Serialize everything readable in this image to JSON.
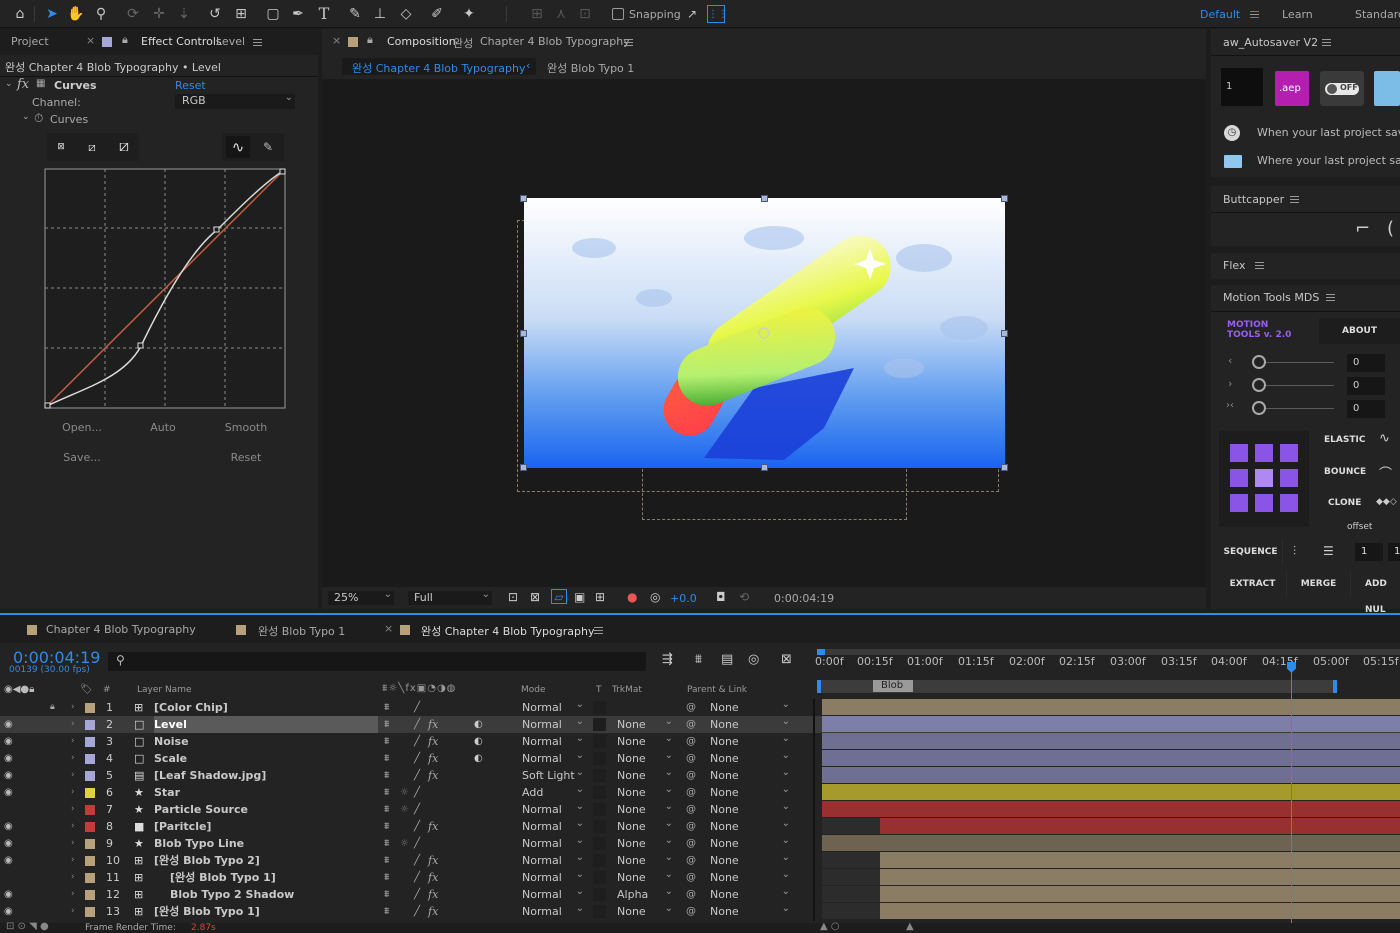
{
  "toolbar": {
    "snapping_label": "Snapping",
    "workspaces": [
      "Default",
      "Learn",
      "Standard"
    ],
    "active_workspace": "Default"
  },
  "project_panel": {
    "tab_project": "Project",
    "tab_effect_controls": "Effect Controls",
    "effect_target": "Level",
    "breadcrumb": "완성 Chapter 4 Blob Typography • Level",
    "effect_name": "Curves",
    "reset_label": "Reset",
    "channel_label": "Channel:",
    "channel_value": "RGB",
    "curves_label": "Curves",
    "buttons": {
      "open": "Open...",
      "auto": "Auto",
      "smooth": "Smooth",
      "save": "Save...",
      "reset": "Reset"
    }
  },
  "comp_panel": {
    "tab_prefix": "Composition",
    "tab_name_kr": "완성",
    "tab_name": "Chapter 4 Blob Typography",
    "flow_active": "완성 Chapter 4 Blob Typography",
    "flow_next": "완성 Blob Typo 1",
    "zoom": "25%",
    "resolution": "Full",
    "exposure": "+0.0",
    "timecode": "0:00:04:19"
  },
  "right_panel": {
    "autosaver_title": "aw_Autosaver V2",
    "autosaver_count": "1",
    "aep_label": ".aep",
    "toggle_label": "OFF",
    "autosaver_when": "When your last project saved",
    "autosaver_where": "Where your last project saved",
    "buttcapper_title": "Buttcapper",
    "flex_title": "Flex",
    "motion_tools_title": "Motion Tools MDS",
    "mt_logo_line1": "MOTION",
    "mt_logo_line2": "TOOLS v. 2.0",
    "mt_about": "ABOUT",
    "mt_values": [
      "0",
      "0",
      "0"
    ],
    "mt_elastic": "ELASTIC",
    "mt_bounce": "BOUNCE",
    "mt_clone": "CLONE",
    "mt_offset": "offset",
    "mt_sequence": "SEQUENCE",
    "mt_seq_value": "1",
    "mt_seq_value2": "1",
    "mt_extract": "EXTRACT",
    "mt_merge": "MERGE",
    "mt_add_null": "ADD NUL"
  },
  "timeline": {
    "tabs": [
      "Chapter 4 Blob Typography",
      "완성 Blob Typo 1",
      "완성 Chapter 4 Blob Typography"
    ],
    "timecode": "0:00:04:19",
    "frames": "00139 (30.00 fps)",
    "headers": {
      "layer_name": "Layer Name",
      "mode": "Mode",
      "t": "T",
      "trkmat": "TrkMat",
      "parent": "Parent & Link",
      "hash": "#"
    },
    "ruler": [
      "0:00f",
      "00:15f",
      "01:00f",
      "01:15f",
      "02:00f",
      "02:15f",
      "03:00f",
      "03:15f",
      "04:00f",
      "04:15f",
      "05:00f",
      "05:15f"
    ],
    "marker_label": "Blob",
    "footer_label": "Frame Render Time:",
    "footer_value": "2.87s",
    "layers": [
      {
        "num": "1",
        "name": "[Color Chip]",
        "mode": "Normal",
        "trkmat": "",
        "parent": "None",
        "label_color": "#b8a07a",
        "visible": false,
        "type": "comp",
        "bar_color": "#8a7d64",
        "bar_start": 0,
        "locked": true
      },
      {
        "num": "2",
        "name": "Level",
        "mode": "Normal",
        "trkmat": "None",
        "parent": "None",
        "label_color": "#a6a7d6",
        "visible": true,
        "type": "solid",
        "bar_color": "#7e7fa8",
        "bar_start": 0,
        "selected": true
      },
      {
        "num": "3",
        "name": "Noise",
        "mode": "Normal",
        "trkmat": "None",
        "parent": "None",
        "label_color": "#a6a7d6",
        "visible": true,
        "type": "solid",
        "bar_color": "#6e6f92",
        "bar_start": 0
      },
      {
        "num": "4",
        "name": "Scale",
        "mode": "Normal",
        "trkmat": "None",
        "parent": "None",
        "label_color": "#a6a7d6",
        "visible": true,
        "type": "solid",
        "bar_color": "#6e6f92",
        "bar_start": 0
      },
      {
        "num": "5",
        "name": "[Leaf Shadow.jpg]",
        "mode": "Soft Light",
        "trkmat": "None",
        "parent": "None",
        "label_color": "#a6a7d6",
        "visible": true,
        "type": "footage",
        "bar_color": "#6e6f92",
        "bar_start": 0
      },
      {
        "num": "6",
        "name": "Star",
        "mode": "Add",
        "trkmat": "None",
        "parent": "None",
        "label_color": "#e0d33a",
        "visible": true,
        "type": "shape",
        "bar_color": "#a79a2c",
        "bar_start": 0
      },
      {
        "num": "7",
        "name": "Particle Source",
        "mode": "Normal",
        "trkmat": "None",
        "parent": "None",
        "label_color": "#c83a3a",
        "visible": false,
        "type": "shape",
        "bar_color": "#983030",
        "bar_start": 0
      },
      {
        "num": "8",
        "name": "[Paritcle]",
        "mode": "Normal",
        "trkmat": "None",
        "parent": "None",
        "label_color": "#c83a3a",
        "visible": true,
        "type": "solid-dark",
        "bar_color": "#983030",
        "bar_start": 0.1
      },
      {
        "num": "9",
        "name": "Blob Typo Line",
        "mode": "Normal",
        "trkmat": "None",
        "parent": "None",
        "label_color": "#b8a07a",
        "visible": true,
        "type": "shape",
        "bar_color": "#6e6350",
        "bar_start": 0
      },
      {
        "num": "10",
        "name": "[완성 Blob Typo 2]",
        "mode": "Normal",
        "trkmat": "None",
        "parent": "None",
        "label_color": "#b8a07a",
        "visible": true,
        "type": "comp",
        "bar_color": "#8a7d64",
        "bar_start": 0.1
      },
      {
        "num": "11",
        "name": "[완성 Blob Typo 1]",
        "mode": "Normal",
        "trkmat": "None",
        "parent": "None",
        "label_color": "#b8a07a",
        "visible": false,
        "type": "comp-track",
        "bar_color": "#8a7d64",
        "bar_start": 0.1
      },
      {
        "num": "12",
        "name": "Blob Typo 2 Shadow",
        "mode": "Normal",
        "trkmat": "Alpha",
        "parent": "None",
        "label_color": "#b8a07a",
        "visible": true,
        "type": "comp-track",
        "bar_color": "#8a7d64",
        "bar_start": 0.1
      },
      {
        "num": "13",
        "name": "[완성 Blob Typo 1]",
        "mode": "Normal",
        "trkmat": "None",
        "parent": "None",
        "label_color": "#b8a07a",
        "visible": true,
        "type": "comp",
        "bar_color": "#8a7d64",
        "bar_start": 0.1
      }
    ]
  }
}
